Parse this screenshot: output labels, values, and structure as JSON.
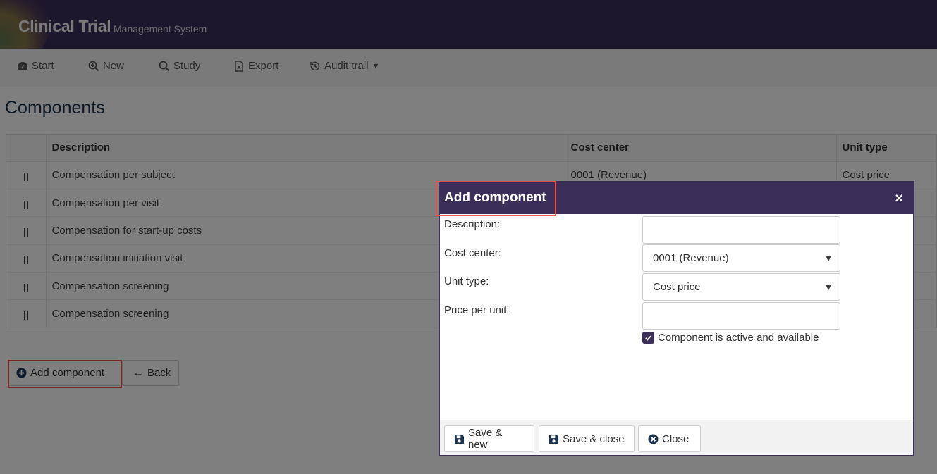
{
  "app": {
    "title": "Clinical Trial",
    "subtitle": "Management System"
  },
  "nav": {
    "items": [
      {
        "label": "Start",
        "icon": "dashboard-icon"
      },
      {
        "label": "New",
        "icon": "zoom-in-icon"
      },
      {
        "label": "Study",
        "icon": "search-icon"
      },
      {
        "label": "Export",
        "icon": "excel-file-icon"
      },
      {
        "label": "Audit trail",
        "icon": "history-icon"
      }
    ]
  },
  "page": {
    "title": "Components"
  },
  "table": {
    "columns": [
      "Description",
      "Cost center",
      "Unit type"
    ],
    "rows": [
      {
        "description": "Compensation per subject",
        "cost_center": "0001 (Revenue)",
        "unit_type": "Cost price"
      },
      {
        "description": "Compensation per visit",
        "cost_center": "",
        "unit_type": ""
      },
      {
        "description": "Compensation for start-up costs",
        "cost_center": "",
        "unit_type": ""
      },
      {
        "description": "Compensation initiation visit",
        "cost_center": "",
        "unit_type": ""
      },
      {
        "description": "Compensation screening",
        "cost_center": "",
        "unit_type": ""
      },
      {
        "description": "Compensation screening",
        "cost_center": "",
        "unit_type": ""
      }
    ]
  },
  "actions": {
    "add_component": "Add component",
    "back": "Back"
  },
  "modal": {
    "title": "Add component",
    "close_symbol": "×",
    "fields": {
      "description_label": "Description:",
      "description_value": "",
      "cost_center_label": "Cost center:",
      "cost_center_value": "0001 (Revenue)",
      "unit_type_label": "Unit type:",
      "unit_type_value": "Cost price",
      "price_label": "Price per unit:",
      "price_value": ""
    },
    "checkbox_label": "Component is active and available",
    "checkbox_checked": true,
    "buttons": {
      "save_new": "Save & new",
      "save_close": "Save & close",
      "close": "Close"
    }
  },
  "colors": {
    "brand_purple": "#3b2f5a",
    "highlight_red": "#e5534b",
    "title_blue": "#1f3550"
  }
}
